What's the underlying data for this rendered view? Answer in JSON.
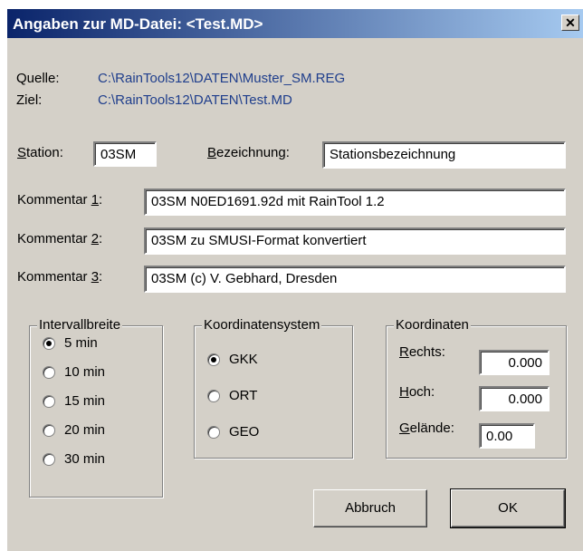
{
  "window": {
    "title": "Angaben zur MD-Datei: <Test.MD>",
    "close_glyph": "✕"
  },
  "source": {
    "label": "Quelle:",
    "value": "C:\\RainTools12\\DATEN\\Muster_SM.REG"
  },
  "target": {
    "label": "Ziel:",
    "value": "C:\\RainTools12\\DATEN\\Test.MD"
  },
  "station": {
    "label_key": "S",
    "label_rest": "tation:",
    "value": "03SM"
  },
  "bezeichnung": {
    "label_key": "B",
    "label_rest": "ezeichnung:",
    "value": "Stationsbezeichnung"
  },
  "comments": [
    {
      "label_pre": "Kommentar ",
      "label_key": "1",
      "label_post": ":",
      "value": "03SM N0ED1691.92d mit RainTool 1.2"
    },
    {
      "label_pre": "Kommentar ",
      "label_key": "2",
      "label_post": ":",
      "value": "03SM zu SMUSI-Format konvertiert"
    },
    {
      "label_pre": "Kommentar ",
      "label_key": "3",
      "label_post": ":",
      "value": "03SM (c) V. Gebhard, Dresden"
    }
  ],
  "intervall": {
    "title": "Intervallbreite",
    "options": [
      "5 min",
      "10 min",
      "15 min",
      "20 min",
      "30 min"
    ],
    "selected": "5 min"
  },
  "koordsystem": {
    "title": "Koordinatensystem",
    "options": [
      "GKK",
      "ORT",
      "GEO"
    ],
    "selected": "GKK"
  },
  "koordinaten": {
    "title": "Koordinaten",
    "rechts": {
      "label_key": "R",
      "label_rest": "echts:",
      "value": "0.000"
    },
    "hoch": {
      "label_key": "H",
      "label_rest": "och:",
      "value": "0.000"
    },
    "gelaende": {
      "label_key": "G",
      "label_rest": "elände:",
      "value": "0.00"
    }
  },
  "buttons": {
    "cancel": "Abbruch",
    "ok": "OK"
  }
}
